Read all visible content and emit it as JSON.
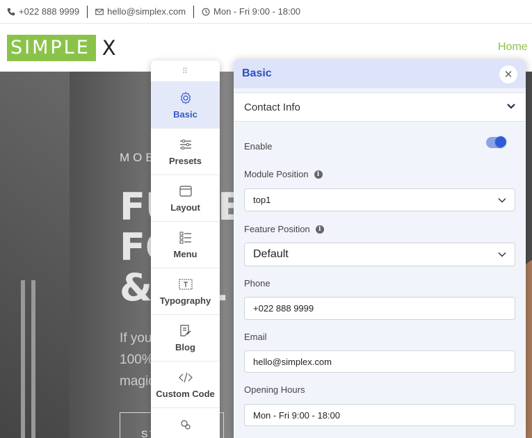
{
  "topbar": {
    "phone": "+022 888 9999",
    "email": "hello@simplex.com",
    "hours": "Mon - Fri 9:00 - 18:00"
  },
  "header": {
    "logo_main": "SIMPLE",
    "logo_x": "X",
    "nav_home": "Home",
    "brand_color": "#8bc34a"
  },
  "hero": {
    "subtitle": "MOB        ON",
    "line1": "FU     RE",
    "line2": "FO     B",
    "line3": "& L       L",
    "para1": "If you          e v",
    "para2": "100%          enc",
    "para3": "magic",
    "button": "ST"
  },
  "tools": {
    "handle": "⠿",
    "items": [
      {
        "label": "Basic",
        "icon": "gear-icon"
      },
      {
        "label": "Presets",
        "icon": "sliders-icon"
      },
      {
        "label": "Layout",
        "icon": "layout-icon"
      },
      {
        "label": "Menu",
        "icon": "menu-icon"
      },
      {
        "label": "Typography",
        "icon": "typography-icon"
      },
      {
        "label": "Blog",
        "icon": "blog-icon"
      },
      {
        "label": "Custom Code",
        "icon": "code-icon"
      }
    ]
  },
  "panel": {
    "title": "Basic",
    "section": "Contact Info",
    "enable_label": "Enable",
    "enable_on": true,
    "module_position_label": "Module Position",
    "module_position_value": "top1",
    "feature_position_label": "Feature Position",
    "feature_position_value": "Default",
    "phone_label": "Phone",
    "phone_value": "+022 888 9999",
    "email_label": "Email",
    "email_value": "hello@simplex.com",
    "hours_label": "Opening Hours",
    "hours_value": "Mon - Fri 9:00 - 18:00",
    "accent": "#2d50c1"
  }
}
